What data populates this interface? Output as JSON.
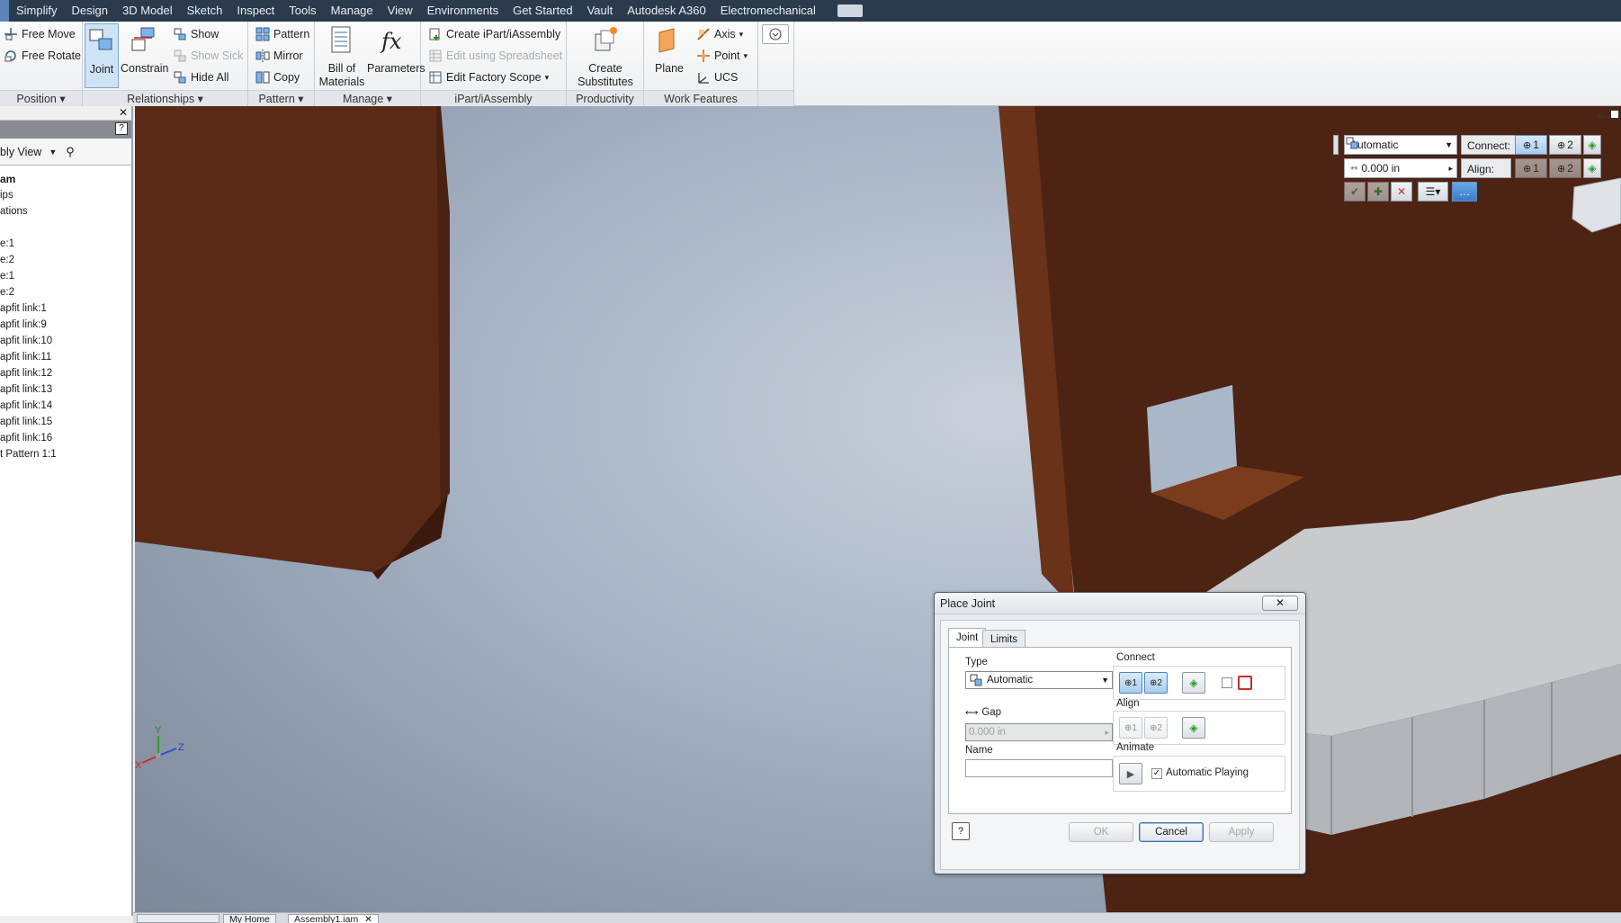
{
  "menu": {
    "tabs": [
      "Simplify",
      "Design",
      "3D Model",
      "Sketch",
      "Inspect",
      "Tools",
      "Manage",
      "View",
      "Environments",
      "Get Started",
      "Vault",
      "Autodesk A360",
      "Electromechanical"
    ]
  },
  "ribbon": {
    "position": {
      "label": "Position",
      "free_move": "Free Move",
      "free_rotate": "Free Rotate"
    },
    "relationships": {
      "label": "Relationships",
      "joint": "Joint",
      "constrain": "Constrain",
      "show": "Show",
      "show_sick": "Show Sick",
      "hide_all": "Hide All"
    },
    "pattern": {
      "label": "Pattern",
      "pattern": "Pattern",
      "mirror": "Mirror",
      "copy": "Copy"
    },
    "manage": {
      "label": "Manage",
      "bom_line1": "Bill of",
      "bom_line2": "Materials",
      "parameters": "Parameters"
    },
    "ipart": {
      "label": "iPart/iAssembly",
      "create": "Create iPart/iAssembly",
      "edit_spreadsheet": "Edit using Spreadsheet",
      "edit_factory": "Edit Factory Scope"
    },
    "productivity": {
      "label": "Productivity",
      "create_line1": "Create",
      "create_line2": "Substitutes"
    },
    "work_features": {
      "label": "Work Features",
      "plane": "Plane",
      "axis": "Axis",
      "point": "Point",
      "ucs": "UCS"
    }
  },
  "browser": {
    "view_label": "bly View",
    "items": [
      "am",
      "ips",
      "ations",
      "",
      "e:1",
      "e:2",
      "e:1",
      "e:2",
      "apfit link:1",
      "apfit link:9",
      "apfit link:10",
      "apfit link:11",
      "apfit link:12",
      "apfit link:13",
      "apfit link:14",
      "apfit link:15",
      "apfit link:16",
      "t Pattern 1:1"
    ]
  },
  "minitoolbar": {
    "type_value": "Automatic",
    "connect_label": "Connect:",
    "align_label": "Align:",
    "gap_value": "0.000 in",
    "btn1": "1",
    "btn2": "2"
  },
  "dialog": {
    "title": "Place Joint",
    "tabs": [
      "Joint",
      "Limits"
    ],
    "type_label": "Type",
    "type_value": "Automatic",
    "gap_label": "Gap",
    "gap_value": "0.000 in",
    "name_label": "Name",
    "name_value": "",
    "connect_label": "Connect",
    "align_label": "Align",
    "animate_label": "Animate",
    "auto_playing": "Automatic Playing",
    "ok": "OK",
    "cancel": "Cancel",
    "apply": "Apply"
  },
  "doctabs": [
    "My Home",
    "Assembly1.iam"
  ],
  "axis_labels": {
    "x": "X",
    "y": "Y",
    "z": "Z"
  },
  "colors": {
    "menubar": "#2b3b4d",
    "wood": "#5a2a17",
    "part_gray": "#c7c9cc",
    "accent": "#5b84b8"
  }
}
